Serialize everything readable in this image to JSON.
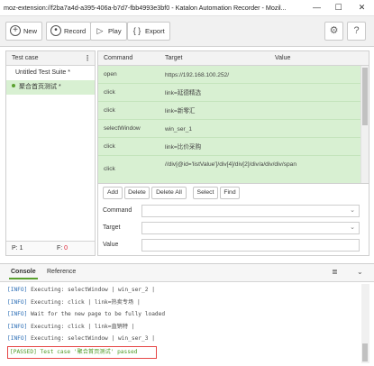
{
  "window": {
    "title": "moz-extension://f2ba7a4d-a395-406a-b7d7-fbb4993e3bf0 - Katalon Automation Recorder - Mozil...",
    "minimize": "—",
    "maximize": "☐",
    "close": "✕"
  },
  "toolbar": {
    "new_label": "New",
    "record_label": "Record",
    "play_label": "Play",
    "export_label": "Export"
  },
  "testcase_panel": {
    "header": "Test case",
    "suite": "Untitled Test Suite *",
    "case": "聚合首页测试 *",
    "passed_label": "P: ",
    "passed_count": "1",
    "failed_label": "F: ",
    "failed_count": "0"
  },
  "table": {
    "headers": {
      "command": "Command",
      "target": "Target",
      "value": "Value"
    },
    "rows": [
      {
        "command": "open",
        "target": "https://192.168.100.252/"
      },
      {
        "command": "click",
        "target": "link=延德精选"
      },
      {
        "command": "click",
        "target": "link=新零汇"
      },
      {
        "command": "selectWindow",
        "target": "win_ser_1"
      },
      {
        "command": "click",
        "target": "link=比价采购"
      },
      {
        "command": "click",
        "target": "//div[@id='listValue']/div[4]/div[2]/div/a/div/div/span"
      }
    ]
  },
  "editor": {
    "add": "Add",
    "delete": "Delete",
    "delete_all": "Delete All",
    "select": "Select",
    "find": "Find",
    "command_label": "Command",
    "target_label": "Target",
    "value_label": "Value"
  },
  "console": {
    "tab_console": "Console",
    "tab_reference": "Reference",
    "logs": [
      {
        "level": "[INFO]",
        "text": " Executing: selectWindow | win_ser_2 |"
      },
      {
        "level": "[INFO]",
        "text": " Executing: click | link=热卖专场 |"
      },
      {
        "level": "[INFO]",
        "text": " Wait for the new page to be fully loaded"
      },
      {
        "level": "[INFO]",
        "text": " Executing: click | link=直销特 |"
      },
      {
        "level": "[INFO]",
        "text": " Executing: selectWindow | win_ser_3 |"
      }
    ],
    "passed": "[PASSED] Test case '聚合首页测试' passed"
  },
  "colors": {
    "executed_row": "#d8f0d2",
    "accent_green": "#5aa12f",
    "info_blue": "#2a6db5",
    "highlight_red": "#e64545"
  }
}
